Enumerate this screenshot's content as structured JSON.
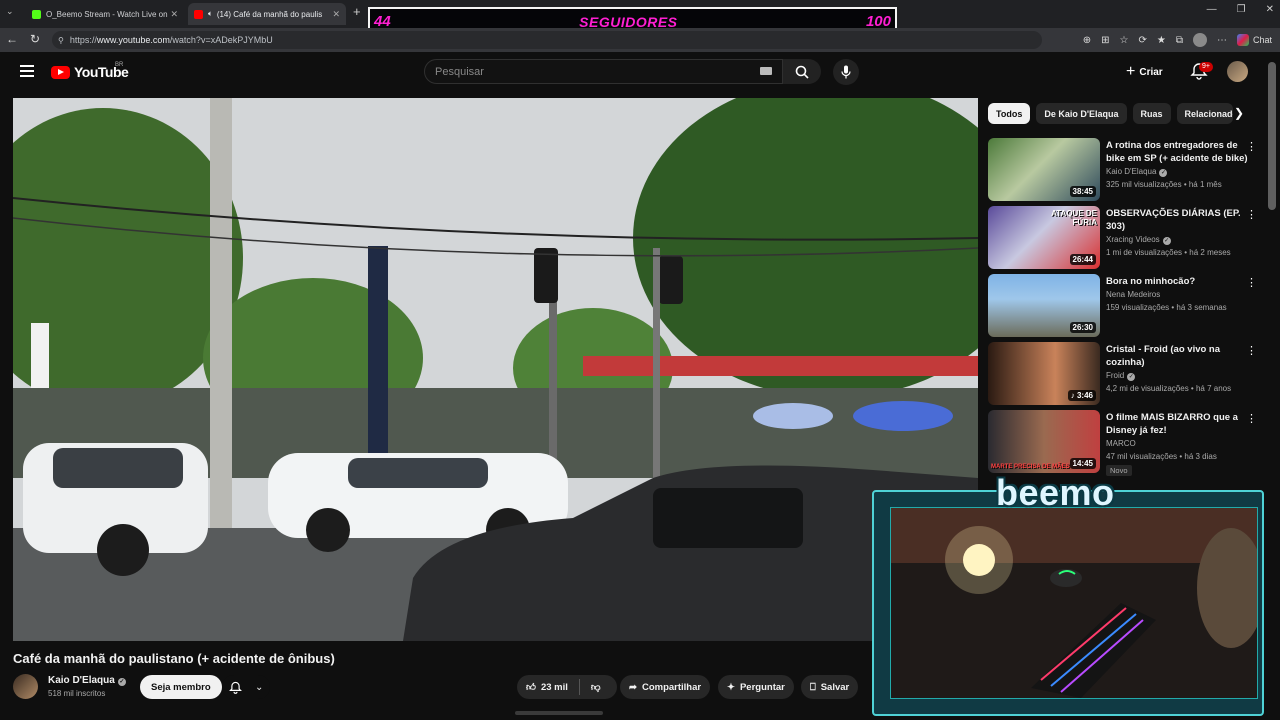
{
  "browser": {
    "tabs": [
      {
        "title": "O_Beemo Stream - Watch Live on",
        "favicon_color": "#53fc18"
      },
      {
        "title": "(14) Café da manhã do paulis",
        "favicon_color": "#ff0000",
        "active": true
      }
    ],
    "url_prefix": "https://",
    "url_host": "www.youtube.com",
    "url_path": "/watch?v=xADekPJYMbU",
    "chat_label": "Chat"
  },
  "overlay": {
    "followers_current": "44",
    "followers_label": "SEGUIDORES",
    "followers_goal": "100",
    "streamer_name": "beemo"
  },
  "header": {
    "logo_text": "YouTube",
    "region": "BR",
    "search_placeholder": "Pesquisar",
    "create_label": "Criar",
    "notification_badge": "9+"
  },
  "video": {
    "title": "Café da manhã do paulistano (+ acidente de ônibus)",
    "channel": "Kaio D'Elaqua",
    "subscribers": "518 mil inscritos",
    "join_label": "Seja membro",
    "likes": "23 mil",
    "share_label": "Compartilhar",
    "ask_label": "Perguntar",
    "save_label": "Salvar"
  },
  "sidebar": {
    "chips": [
      "Todos",
      "De Kaio D'Elaqua",
      "Ruas",
      "Relacionados"
    ],
    "recommendations": [
      {
        "title": "A rotina dos entregadores de bike em SP (+ acidente de bike)",
        "channel": "Kaio D'Elaqua",
        "verified": true,
        "meta": "325 mil visualizações • há 1 mês",
        "duration": "38:45",
        "thumb": "linear-gradient(135deg,#4c7a3a,#b8c9a0 45%,#2f4a5c)"
      },
      {
        "title": "OBSERVAÇÕES DIÁRIAS (EP. 303)",
        "channel": "Xracing Videos",
        "verified": true,
        "meta": "1 mi de visualizações • há 2 meses",
        "duration": "26:44",
        "thumb": "linear-gradient(135deg,#5a4a9a,#c8c8e0 45%,#d93030)",
        "thumb_text": "ATAQUE DE FÚRIA"
      },
      {
        "title": "Bora no minhocão?",
        "channel": "Nena Medeiros",
        "verified": false,
        "meta": "159 visualizações • há 3 semanas",
        "duration": "26:30",
        "thumb": "linear-gradient(180deg,#7fb3e6,#9fc7ea 40%,#6b6b5a)"
      },
      {
        "title": "Cristal - Froid (ao vivo na cozinha)",
        "channel": "Froid",
        "verified": true,
        "meta": "4,2 mi de visualizações • há 7 anos",
        "duration": "3:46",
        "thumb": "linear-gradient(90deg,#2a1a12,#c9825a 60%,#3a2a20)",
        "playing_icon": true
      },
      {
        "title": "O filme MAIS BIZARRO que a Disney já fez!",
        "channel": "MARCO",
        "verified": false,
        "meta": "47 mil visualizações • há 3 dias",
        "duration": "14:45",
        "thumb": "linear-gradient(90deg,#2a2a30,#9a6a50 50%,#c04040)",
        "thumb_text": "MARTE PRECISA DE MÃES",
        "badge": "Novo"
      }
    ]
  },
  "colors": {
    "accent_red": "#ff0000",
    "overlay_magenta": "#ff1fd2",
    "overlay_cyan": "#4fd2d6"
  }
}
